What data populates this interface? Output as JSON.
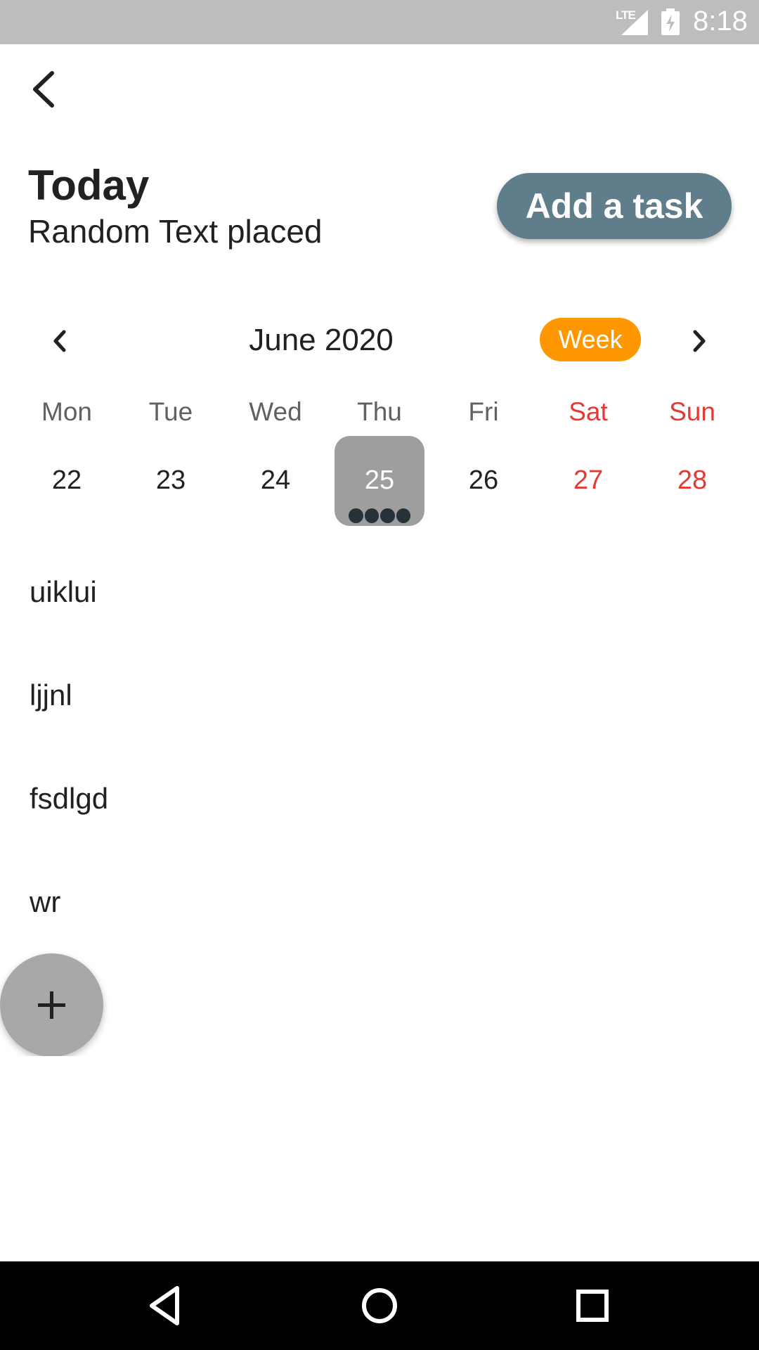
{
  "status_bar": {
    "network": "LTE",
    "time": "8:18"
  },
  "header": {
    "title": "Today",
    "subtitle": "Random Text placed",
    "add_task_label": "Add a task"
  },
  "calendar": {
    "month_label": "June 2020",
    "view_toggle_label": "Week",
    "days": [
      {
        "name": "Mon",
        "date": "22",
        "weekend": false,
        "selected": false,
        "events": 0
      },
      {
        "name": "Tue",
        "date": "23",
        "weekend": false,
        "selected": false,
        "events": 0
      },
      {
        "name": "Wed",
        "date": "24",
        "weekend": false,
        "selected": false,
        "events": 0
      },
      {
        "name": "Thu",
        "date": "25",
        "weekend": false,
        "selected": true,
        "events": 4
      },
      {
        "name": "Fri",
        "date": "26",
        "weekend": false,
        "selected": false,
        "events": 0
      },
      {
        "name": "Sat",
        "date": "27",
        "weekend": true,
        "selected": false,
        "events": 0
      },
      {
        "name": "Sun",
        "date": "28",
        "weekend": true,
        "selected": false,
        "events": 0
      }
    ]
  },
  "tasks": [
    {
      "title": "uiklui"
    },
    {
      "title": "ljjnl"
    },
    {
      "title": "fsdlgd"
    },
    {
      "title": "wr"
    }
  ],
  "colors": {
    "accent": "#607d8b",
    "week_toggle": "#ff9800",
    "weekend": "#e53935",
    "selected_day": "#9e9e9e",
    "fab": "#a8a8a8"
  },
  "icons": {
    "back": "arrow-back-icon",
    "prev": "chevron-left-icon",
    "next": "chevron-right-icon",
    "fab": "plus-icon",
    "nav_back": "triangle-back-icon",
    "nav_home": "circle-home-icon",
    "nav_recents": "square-recents-icon"
  }
}
